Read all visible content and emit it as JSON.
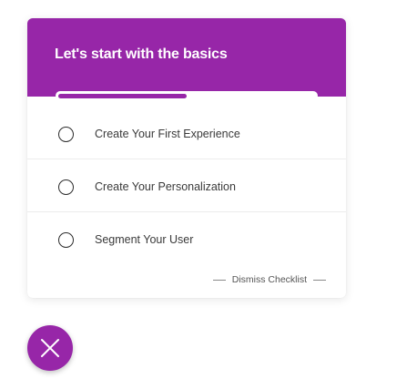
{
  "checklist": {
    "title": "Let's start with the basics",
    "progress": 0.5,
    "items": [
      {
        "label": "Create Your First Experience",
        "checked": false
      },
      {
        "label": "Create Your Personalization",
        "checked": false
      },
      {
        "label": "Segment Your User",
        "checked": false
      }
    ],
    "dismiss_label": "Dismiss Checklist"
  },
  "fab": {
    "icon": "close-icon"
  },
  "colors": {
    "accent": "#9726a8",
    "text": "#3a3a3a"
  }
}
